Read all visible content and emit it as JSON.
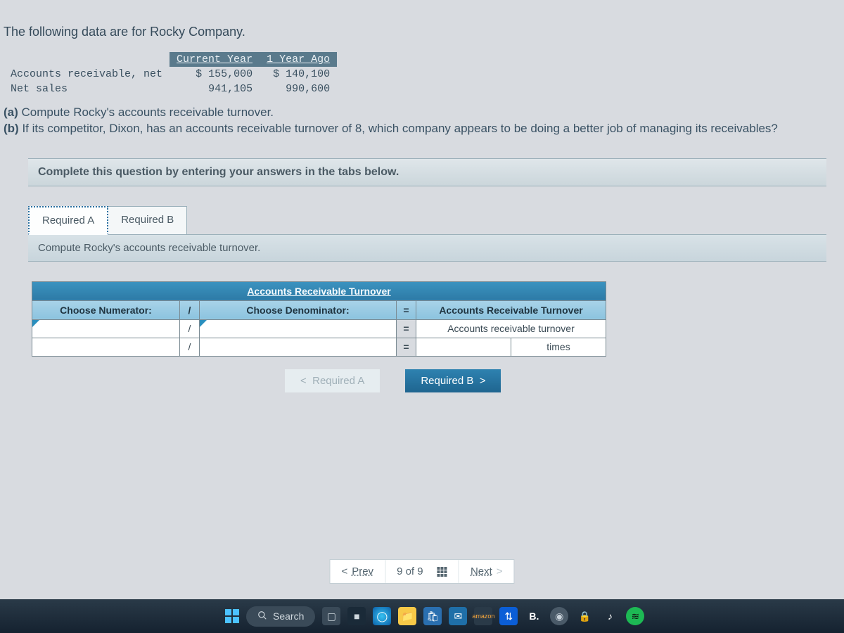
{
  "intro": "The following data are for Rocky Company.",
  "data_table": {
    "headers": [
      "Current Year",
      "1 Year Ago"
    ],
    "rows": [
      {
        "label": "Accounts receivable, net",
        "c1": "$ 155,000",
        "c2": "$ 140,100"
      },
      {
        "label": "Net sales",
        "c1": "941,105",
        "c2": "990,600"
      }
    ]
  },
  "questions": {
    "a_prefix": "(a)",
    "a_text": " Compute Rocky's accounts receivable turnover.",
    "b_prefix": "(b)",
    "b_text": " If its competitor, Dixon, has an accounts receivable turnover of 8, which company appears to be doing a better job of managing its receivables?"
  },
  "instruction": "Complete this question by entering your answers in the tabs below.",
  "tabs": {
    "a": "Required A",
    "b": "Required B"
  },
  "subheader": "Compute Rocky's accounts receivable turnover.",
  "calc": {
    "top_header": "Accounts Receivable Turnover",
    "col_numerator": "Choose Numerator:",
    "col_slash": "/",
    "col_denominator": "Choose Denominator:",
    "col_eq": "=",
    "col_result": "Accounts Receivable Turnover",
    "row2_eq": "=",
    "row2_result": "Accounts receivable turnover",
    "row3_eq": "=",
    "row3_unit": "times"
  },
  "nav": {
    "prev": "Required A",
    "next": "Required B"
  },
  "pager": {
    "prev": "Prev",
    "pos": "9 of 9",
    "next": "Next"
  },
  "taskbar": {
    "search": "Search",
    "b_label": "B."
  }
}
